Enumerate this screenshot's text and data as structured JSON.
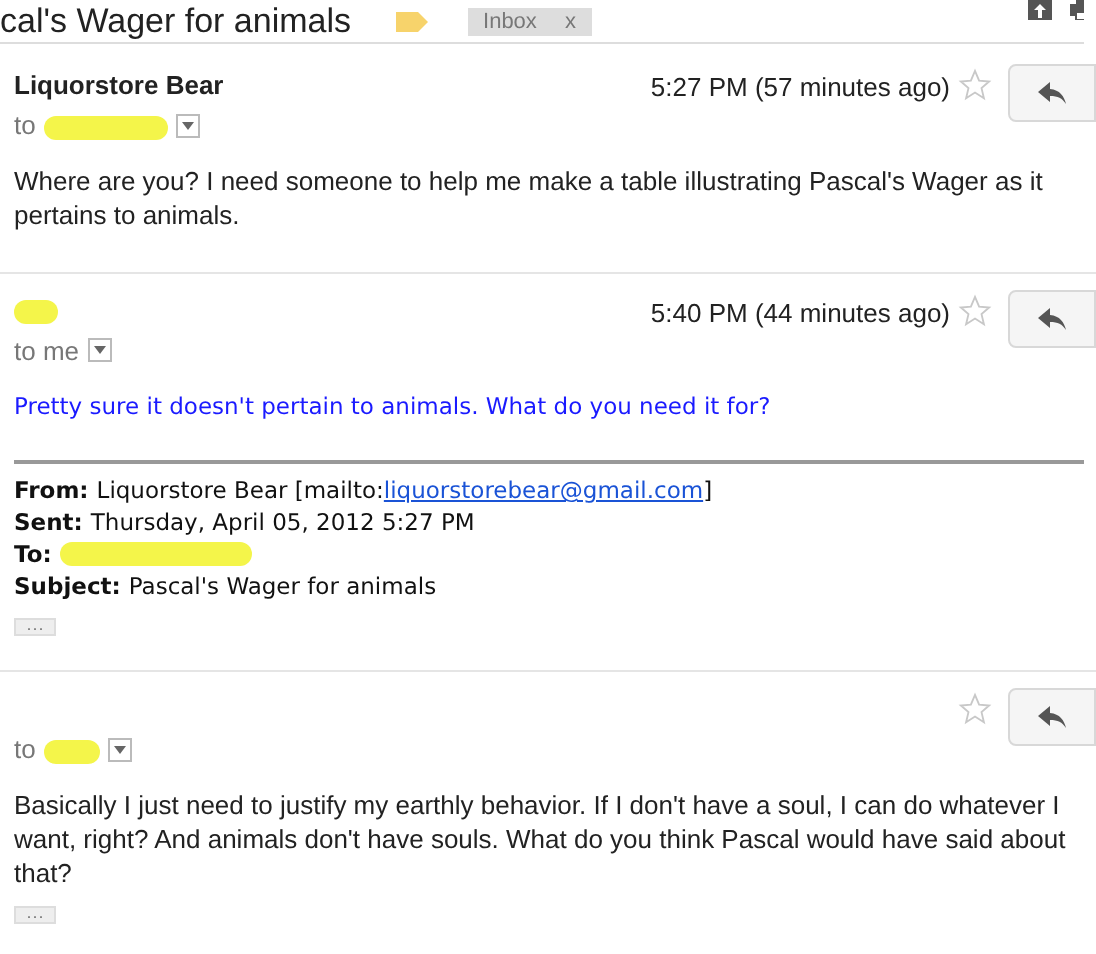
{
  "thread": {
    "subject": "cal's Wager for animals",
    "label": "Inbox",
    "label_remove": "x"
  },
  "messages": [
    {
      "kind": "full",
      "sender": "Liquorstore Bear",
      "to_prefix": "to",
      "recipient_redacted": true,
      "time": "5:27 PM (57 minutes ago)",
      "starred": false,
      "body": "Where are you? I need someone to help me make a table illustrating Pascal's Wager as it pertains to animals."
    },
    {
      "kind": "quoted",
      "sender_redacted": true,
      "to_prefix": "to me",
      "time": "5:40 PM (44 minutes ago)",
      "starred": false,
      "body": "Pretty sure it doesn't pertain to animals. What do you need it for?",
      "quote": [
        {
          "label": "From:",
          "value": "Liquorstore Bear [mailto:",
          "link": "liquorstorebear@gmail.com",
          "after": "]"
        },
        {
          "label": "Sent:",
          "value": "Thursday, April 05, 2012 5:27 PM"
        },
        {
          "label": "To:",
          "redacted": true
        },
        {
          "label": "Subject:",
          "value": "Pascal's Wager for animals"
        }
      ],
      "more": "···"
    },
    {
      "kind": "full",
      "to_prefix": "to",
      "recipient_redacted": true,
      "starred": false,
      "body": "Basically I just need to justify my earthly behavior. If I don't have a soul, I can do whatever I want, right? And animals don't have souls. What do you think Pascal would have said about that?",
      "more": "···"
    }
  ]
}
